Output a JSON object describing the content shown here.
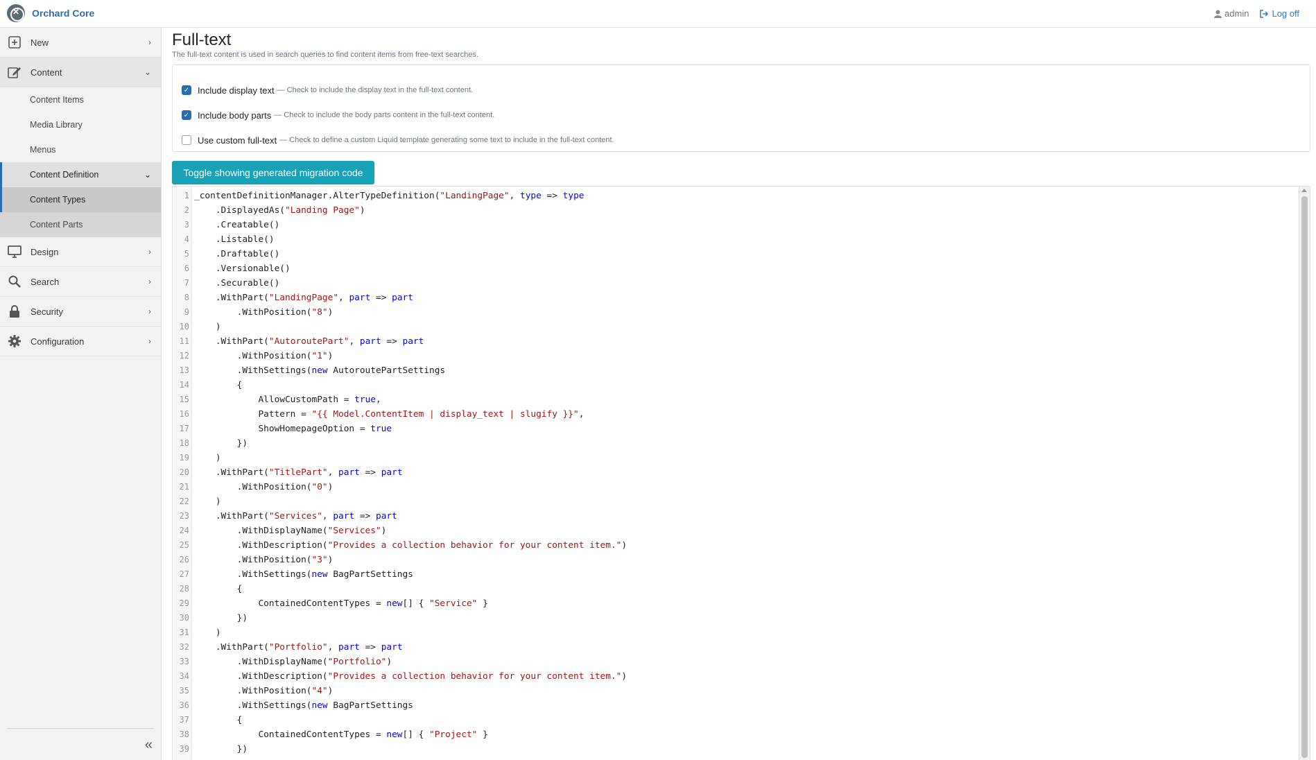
{
  "app": {
    "brand_name": "Orchard Core",
    "user_label": "admin",
    "logoff_label": "Log off"
  },
  "sidebar": {
    "new": "New",
    "content": "Content",
    "content_items": "Content Items",
    "media_library": "Media Library",
    "menus": "Menus",
    "content_definition": "Content Definition",
    "content_types": "Content Types",
    "content_parts": "Content Parts",
    "design": "Design",
    "search": "Search",
    "security": "Security",
    "configuration": "Configuration"
  },
  "main": {
    "title": "Full-text",
    "hint": "The full-text content is used in search queries to find content items from free-text searches.",
    "options": [
      {
        "label": "Include display text",
        "hint": "— Check to include the display text in the full-text content.",
        "checked": true
      },
      {
        "label": "Include body parts",
        "hint": "— Check to include the body parts content in the full-text content.",
        "checked": true
      },
      {
        "label": "Use custom full-text",
        "hint": "— Check to define a custom Liquid template generating some text to include in the full-text content.",
        "checked": false
      }
    ],
    "toggle_button": "Toggle showing generated migration code"
  },
  "code_lines": [
    "_contentDefinitionManager.AlterTypeDefinition(\"LandingPage\", type => type",
    "    .DisplayedAs(\"Landing Page\")",
    "    .Creatable()",
    "    .Listable()",
    "    .Draftable()",
    "    .Versionable()",
    "    .Securable()",
    "    .WithPart(\"LandingPage\", part => part",
    "        .WithPosition(\"8\")",
    "    )",
    "    .WithPart(\"AutoroutePart\", part => part",
    "        .WithPosition(\"1\")",
    "        .WithSettings(new AutoroutePartSettings",
    "        {",
    "            AllowCustomPath = true,",
    "            Pattern = \"{{ Model.ContentItem | display_text | slugify }}\",",
    "            ShowHomepageOption = true",
    "        })",
    "    )",
    "    .WithPart(\"TitlePart\", part => part",
    "        .WithPosition(\"0\")",
    "    )",
    "    .WithPart(\"Services\", part => part",
    "        .WithDisplayName(\"Services\")",
    "        .WithDescription(\"Provides a collection behavior for your content item.\")",
    "        .WithPosition(\"3\")",
    "        .WithSettings(new BagPartSettings",
    "        {",
    "            ContainedContentTypes = new[] { \"Service\" }",
    "        })",
    "    )",
    "    .WithPart(\"Portfolio\", part => part",
    "        .WithDisplayName(\"Portfolio\")",
    "        .WithDescription(\"Provides a collection behavior for your content item.\")",
    "        .WithPosition(\"4\")",
    "        .WithSettings(new BagPartSettings",
    "        {",
    "            ContainedContentTypes = new[] { \"Project\" }",
    "        })"
  ],
  "colors": {
    "keyword": "#0000ff",
    "string": "#a31515",
    "accent": "#2b6cb0",
    "button": "#17a2b8"
  }
}
